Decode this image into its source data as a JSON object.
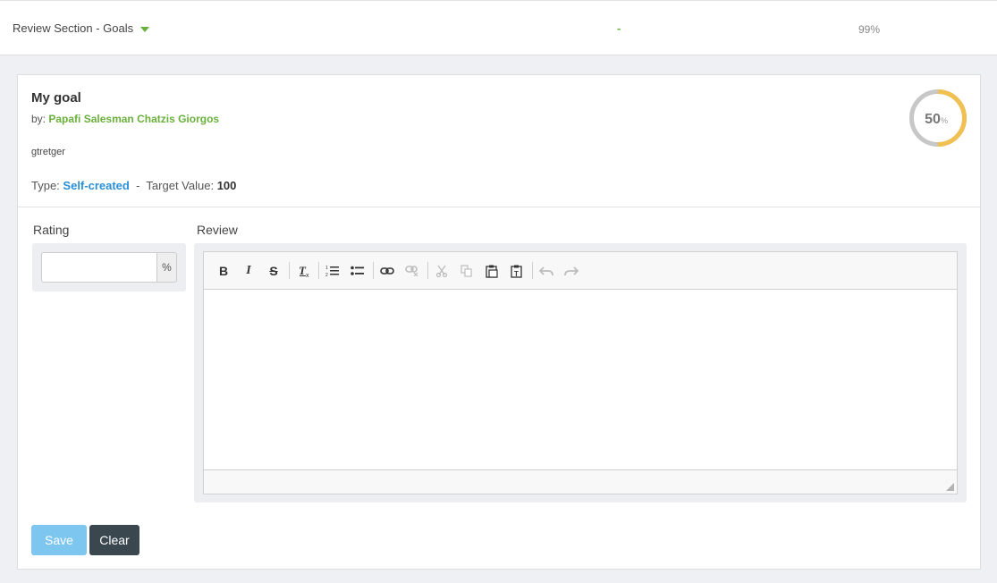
{
  "section": {
    "title": "Review Section - Goals",
    "dash": "-",
    "percent": "99%"
  },
  "goal": {
    "title": "My goal",
    "by_prefix": "by:",
    "author": "Papafi Salesman Chatzis Giorgos",
    "description": "gtretger",
    "type_label": "Type:",
    "type_value": "Self-created",
    "separator": "-",
    "target_label": "Target Value:",
    "target_value": "100",
    "progress": {
      "value": "50",
      "unit": "%",
      "fraction": 0.5,
      "color_filled": "#f0c050",
      "color_track": "#c7c7c7"
    }
  },
  "rating": {
    "label": "Rating",
    "value": "",
    "addon": "%"
  },
  "review": {
    "label": "Review",
    "toolbar": [
      {
        "icon": "bold-icon",
        "label": "B"
      },
      {
        "icon": "italic-icon",
        "label": "I"
      },
      {
        "icon": "strikethrough-icon",
        "label": "S"
      },
      {
        "icon": "remove-format-icon",
        "label": "Tx"
      },
      {
        "icon": "numbered-list-icon",
        "label": "ol"
      },
      {
        "icon": "bulleted-list-icon",
        "label": "ul"
      },
      {
        "icon": "link-icon",
        "label": "link"
      },
      {
        "icon": "unlink-icon",
        "label": "unlink"
      },
      {
        "icon": "cut-icon",
        "label": "cut"
      },
      {
        "icon": "copy-icon",
        "label": "copy"
      },
      {
        "icon": "paste-icon",
        "label": "paste"
      },
      {
        "icon": "paste-text-icon",
        "label": "paste-text"
      },
      {
        "icon": "undo-icon",
        "label": "undo"
      },
      {
        "icon": "redo-icon",
        "label": "redo"
      }
    ]
  },
  "actions": {
    "save_label": "Save",
    "clear_label": "Clear"
  },
  "colors": {
    "accent_green": "#6ab03c",
    "link_blue": "#2a8fd6",
    "save_button": "#7cc6f0",
    "clear_button": "#3a474f"
  }
}
